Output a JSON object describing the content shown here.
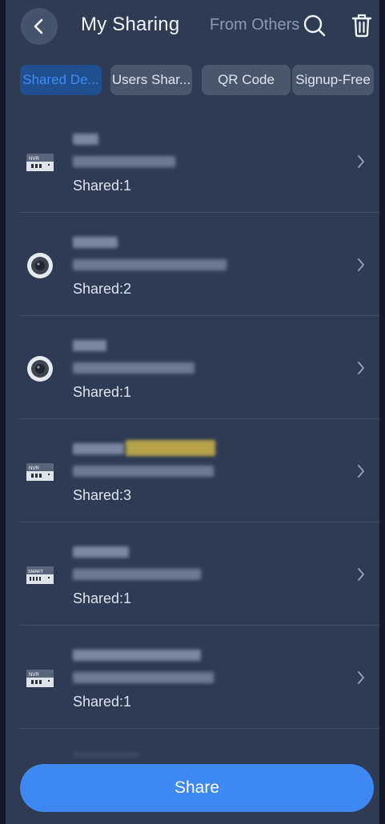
{
  "header": {
    "title": "My Sharing",
    "from_others": "From Others",
    "back_icon": "chevron-left-icon",
    "search_icon": "search-icon",
    "trash_icon": "trash-icon"
  },
  "tabs": [
    {
      "label": "Shared De...",
      "active": true
    },
    {
      "label": "Users Shar...",
      "active": false
    },
    {
      "label": "QR Code",
      "active": false
    },
    {
      "label": "Signup-Free",
      "active": false
    }
  ],
  "devices": [
    {
      "type": "nvr",
      "icon_label": "NVR",
      "shared": "Shared:1"
    },
    {
      "type": "camera",
      "shared": "Shared:2"
    },
    {
      "type": "camera",
      "shared": "Shared:1"
    },
    {
      "type": "nvr",
      "icon_label": "NVR",
      "shared": "Shared:3"
    },
    {
      "type": "smart",
      "icon_label": "SMART",
      "shared": "Shared:1"
    },
    {
      "type": "nvr",
      "icon_label": "NVR",
      "shared": "Shared:1"
    }
  ],
  "share_button": "Share",
  "colors": {
    "background": "#2e3b52",
    "accent": "#3f87f2",
    "active_tab_bg": "#1f4f8e",
    "active_tab_text": "#3f8cf6"
  }
}
